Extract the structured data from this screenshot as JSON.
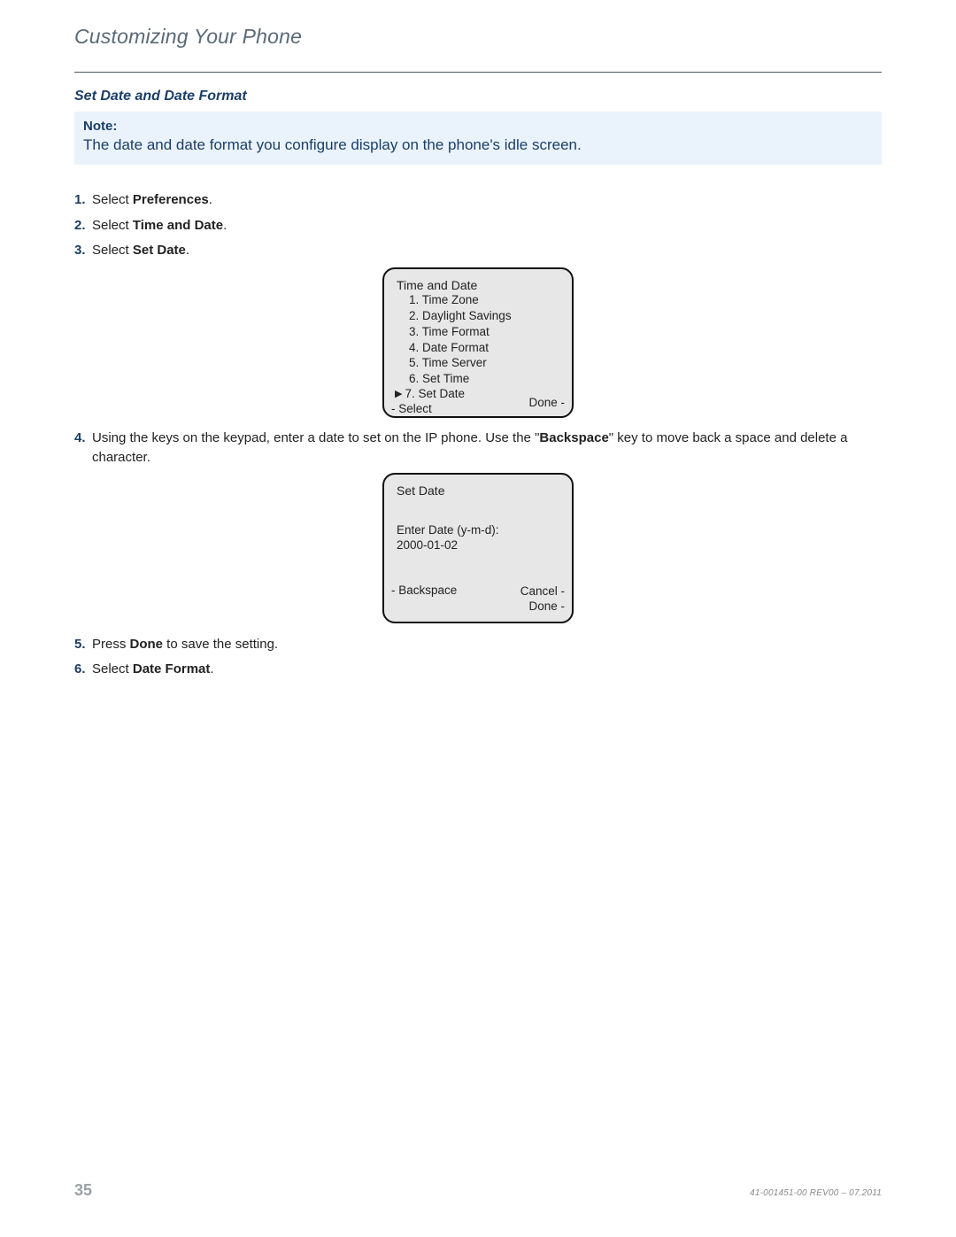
{
  "chapter_title": "Customizing Your Phone",
  "section_heading": "Set Date and Date Format",
  "note": {
    "label": "Note:",
    "body": "The date and date format you configure display on the phone's idle screen."
  },
  "steps": {
    "s1": {
      "num": "1.",
      "prefix": "Select ",
      "bold": "Preferences",
      "suffix": "."
    },
    "s2": {
      "num": "2.",
      "prefix": "Select ",
      "bold": "Time and Date",
      "suffix": "."
    },
    "s3": {
      "num": "3.",
      "prefix": "Select ",
      "bold": "Set Date",
      "suffix": "."
    },
    "s4": {
      "num": "4.",
      "text_a": "Using the keys on the keypad, enter a date to set on the IP phone. Use the ",
      "quote_open": "\"",
      "bold": "Backspace",
      "text_b": "\" key to move back a space and delete a character."
    },
    "s5": {
      "num": "5.",
      "prefix": "Press ",
      "bold": "Done",
      "suffix": " to save the setting."
    },
    "s6": {
      "num": "6.",
      "prefix": "Select ",
      "bold": "Date Format",
      "suffix": "."
    }
  },
  "screen1": {
    "title": "Time and Date",
    "items": {
      "i1": "Time Zone",
      "i2": "Daylight Savings",
      "i3": "Time Format",
      "i4": "Date Format",
      "i5": "Time Server",
      "i6": "Set Time",
      "i7": "Set Date"
    },
    "soft_left": "- Select",
    "soft_right": "Done -"
  },
  "screen2": {
    "title": "Set Date",
    "prompt": "Enter Date (y-m-d):",
    "value": "2000-01-02",
    "backspace": "- Backspace",
    "cancel": "Cancel -",
    "done": "Done -"
  },
  "footer": {
    "page": "35",
    "docid": "41-001451-00 REV00 – 07.2011"
  }
}
